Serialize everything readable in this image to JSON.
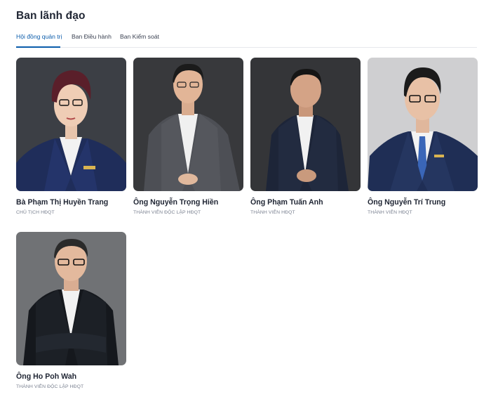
{
  "page": {
    "title": "Ban lãnh đạo"
  },
  "tabs": [
    {
      "label": "Hội đồng quản trị",
      "active": true
    },
    {
      "label": "Ban Điều hành",
      "active": false
    },
    {
      "label": "Ban Kiểm soát",
      "active": false
    }
  ],
  "members": [
    {
      "name": "Bà Phạm Thị Huyền Trang",
      "role": "CHỦ TỊCH HĐQT"
    },
    {
      "name": "Ông Nguyễn Trọng Hiền",
      "role": "THÀNH VIÊN ĐỘC LẬP HĐQT"
    },
    {
      "name": "Ông Phạm Tuấn Anh",
      "role": "THÀNH VIÊN HĐQT"
    },
    {
      "name": "Ông Nguyễn Trí Trung",
      "role": "THÀNH VIÊN HĐQT"
    },
    {
      "name": "Ông Ho Poh Wah",
      "role": "THÀNH VIÊN ĐỘC LẬP HĐQT"
    }
  ],
  "colors": {
    "accent": "#0b5cab",
    "divider": "#e6e8ec",
    "text": "#1f2533",
    "muted": "#7a8190"
  }
}
